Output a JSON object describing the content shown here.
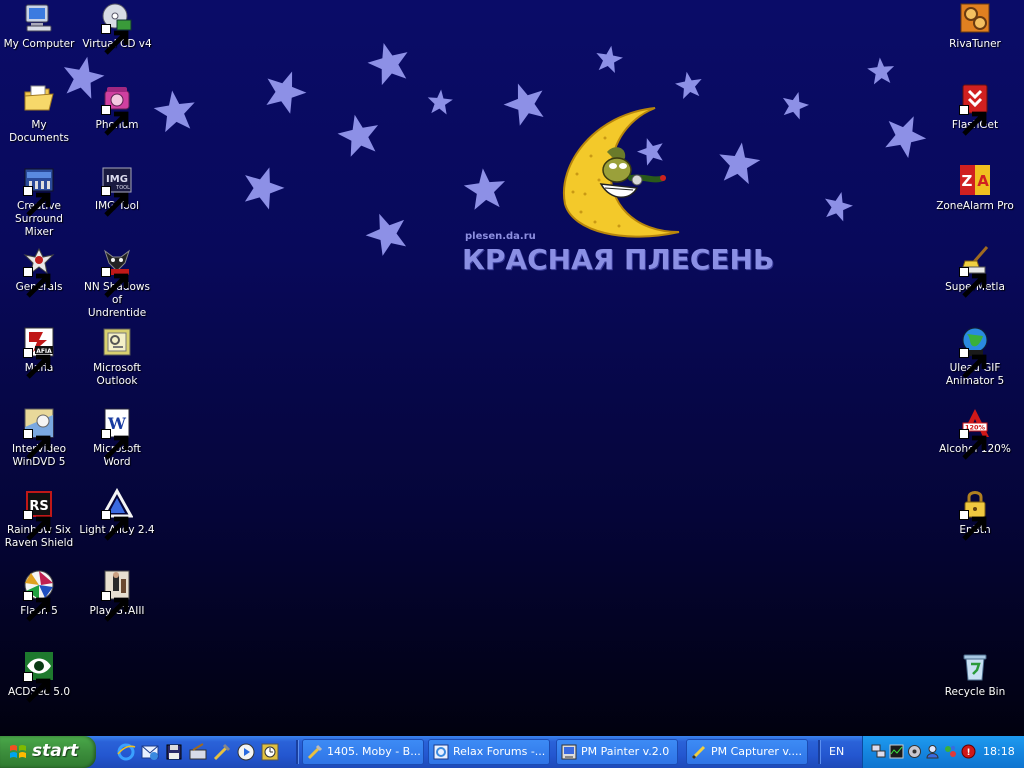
{
  "wallpaper": {
    "site_url": "plesen.da.ru",
    "band_title": "КРАСНАЯ ПЛЕСЕНЬ",
    "star_color": "#8d90e6",
    "background_top": "#0a0c68",
    "background_bottom": "#01010f"
  },
  "desktop_icons": {
    "my_computer": "My Computer",
    "virtual_cd": "Virtual CD v4",
    "my_documents": "My Documents",
    "phonum": "Phonum",
    "creative_mixer_1": "Creative",
    "creative_mixer_2": "Surround Mixer",
    "img_tool": "IMG Tool",
    "generals": "Generals",
    "nn_shadows_1": "NN Shadows of",
    "nn_shadows_2": "Undrentide",
    "mafia": "Mafia",
    "outlook_1": "Microsoft",
    "outlook_2": "Outlook",
    "windvd_1": "InterVideo",
    "windvd_2": "WinDVD 5",
    "word": "Microsoft Word",
    "rainbow_1": "Rainbow Six",
    "rainbow_2": "Raven Shield",
    "light_alloy": "Light Alloy 2.4",
    "flash": "Flash 5",
    "gta": "Play GTAIII",
    "acdsee": "ACDSee 5.0",
    "rivatuner": "RivaTuner",
    "flashget": "FlashGet",
    "zonealarm": "ZoneAlarm Pro",
    "supermetla": "SuperMetla",
    "ulead_1": "Ulead GIF",
    "ulead_2": "Animator 5",
    "alcohol": "Alcohol 120%",
    "enbtn": "EnBtn",
    "recycle_bin": "Recycle Bin"
  },
  "taskbar": {
    "start_label": "start",
    "quick_launch": [
      "ie-icon",
      "outlook-express-icon",
      "save-icon",
      "show-desktop-icon",
      "tools-icon",
      "media-player-icon",
      "clock-app-icon"
    ],
    "tasks": [
      "1405. Moby - B...",
      "Relax Forums -...",
      "PM Painter v.2.0",
      "PM Capturer v...."
    ],
    "language": "EN",
    "clock": "18:18",
    "taskbar_color": "#2457d0",
    "start_color": "#3c8e3c",
    "tray_color": "#1586e0"
  }
}
